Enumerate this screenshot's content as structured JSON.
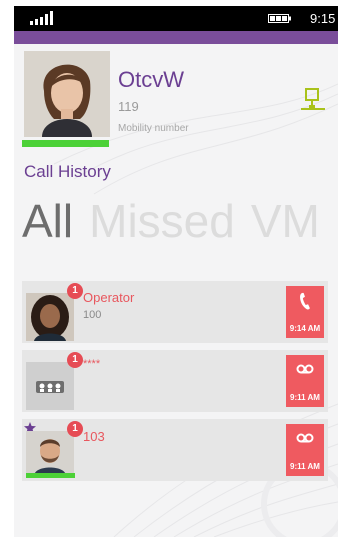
{
  "status_bar": {
    "time": "9:15",
    "signal_icon": "signal-bars-icon",
    "battery_icon": "battery-icon"
  },
  "profile": {
    "name": "OtcvW",
    "number": "119",
    "number_label": "Mobility number",
    "presence_color": "#4cd137",
    "network_icon": "network-icon"
  },
  "call_history": {
    "title": "Call History",
    "tabs": [
      "All",
      "Missed",
      "VM"
    ],
    "active_tab": "All"
  },
  "calls": [
    {
      "name": "Operator",
      "detail": "100",
      "badge": "1",
      "action_icon": "phone-icon",
      "time": "9:14 AM",
      "avatar": "woman-avatar"
    },
    {
      "name": "****",
      "detail": "",
      "badge": "1",
      "action_icon": "voicemail-icon",
      "time": "9:11 AM",
      "avatar": "group-avatar"
    },
    {
      "name": "103",
      "detail": "",
      "badge": "1",
      "action_icon": "voicemail-icon",
      "time": "9:11 AM",
      "avatar": "man-avatar",
      "favorite_icon": "star-icon"
    }
  ],
  "colors": {
    "accent": "#7a4d9a",
    "missed_red": "#e8575e",
    "action_red": "#ef5a60",
    "presence_green": "#4cd137",
    "network_green": "#a9c21b"
  }
}
